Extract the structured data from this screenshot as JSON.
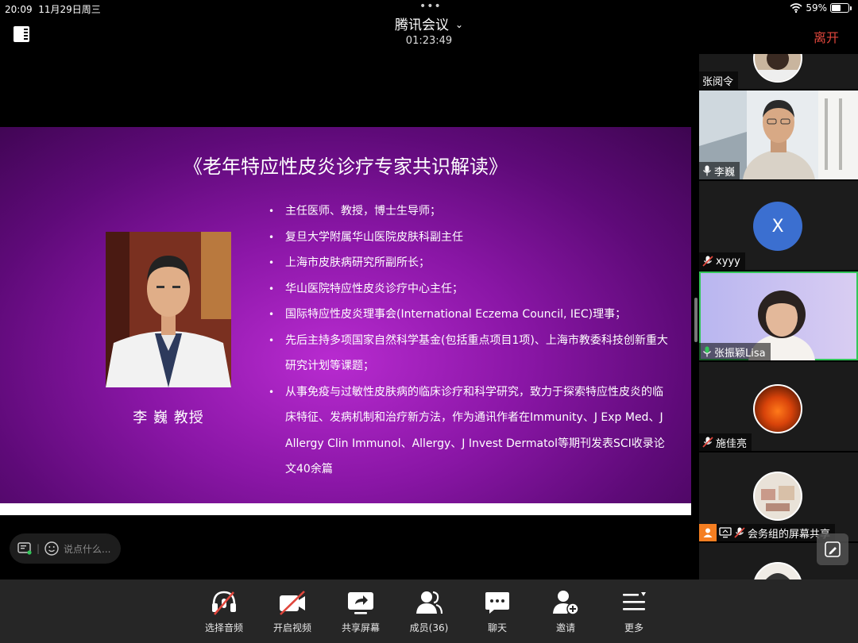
{
  "status_bar": {
    "time": "20:09",
    "date": "11月29日周三",
    "battery": "59%",
    "battery_level": 0.59
  },
  "header": {
    "title": "腾讯会议",
    "timer": "01:23:49",
    "leave_label": "离开"
  },
  "slide": {
    "title": "《老年特应性皮炎诊疗专家共识解读》",
    "speaker_name": "李 巍 教授",
    "bullets": [
      "主任医师、教授，博士生导师；",
      "复旦大学附属华山医院皮肤科副主任",
      "上海市皮肤病研究所副所长；",
      "华山医院特应性皮炎诊疗中心主任；",
      "国际特应性皮炎理事会(International Eczema Council, IEC)理事；",
      "先后主持多项国家自然科学基金(包括重点项目1项)、上海市教委科技创新重大研究计划等课题；",
      "从事免疫与过敏性皮肤病的临床诊疗和科学研究，致力于探索特应性皮炎的临床特征、发病机制和治疗新方法，作为通讯作者在Immunity、J Exp Med、J Allergy Clin Immunol、Allergy、J Invest Dermatol等期刊发表SCI收录论文40余篇"
    ]
  },
  "chat": {
    "placeholder": "说点什么..."
  },
  "participants": [
    {
      "name": "张阅令"
    },
    {
      "name": "李巍"
    },
    {
      "name": "xyyy",
      "initial": "X"
    },
    {
      "name": "张振颖Lisa"
    },
    {
      "name": "施佳亮"
    },
    {
      "name": "会务组的屏幕共享"
    }
  ],
  "toolbar": {
    "audio": "选择音频",
    "video": "开启视频",
    "share": "共享屏幕",
    "members": "成员(36)",
    "chat": "聊天",
    "invite": "邀请",
    "more": "更多"
  },
  "colors": {
    "leave": "#e0463c",
    "active_speaker_border": "#33c65a",
    "avatar_blue": "#3b6fd0",
    "slide_purple": "#8a16a6"
  }
}
